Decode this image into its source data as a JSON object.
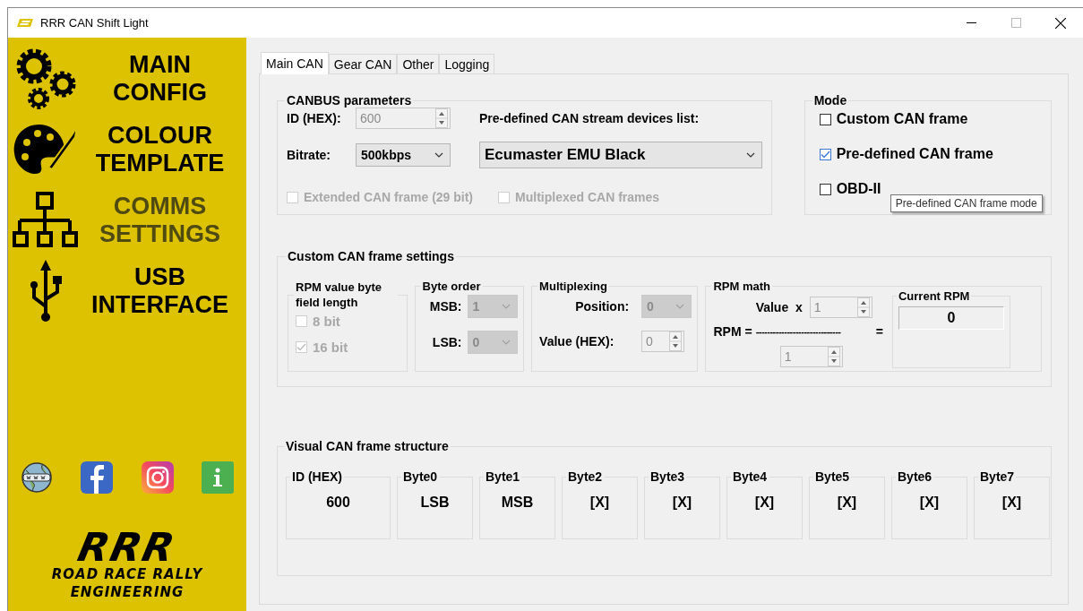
{
  "window": {
    "title": "RRR CAN Shift Light"
  },
  "sidebar": {
    "items": [
      {
        "kind": "gears",
        "label": "MAIN\nCONFIG",
        "selected": false
      },
      {
        "kind": "palette",
        "label": "COLOUR\nTEMPLATE",
        "selected": false
      },
      {
        "kind": "network",
        "label": "COMMS\nSETTINGS",
        "selected": true
      },
      {
        "kind": "usb",
        "label": "USB\nINTERFACE",
        "selected": false
      }
    ],
    "links": [
      {
        "kind": "web"
      },
      {
        "kind": "facebook"
      },
      {
        "kind": "instagram"
      },
      {
        "kind": "info"
      }
    ],
    "logo": {
      "title": "RRR",
      "line1": "ROAD RACE RALLY",
      "line2": "ENGINEERING"
    }
  },
  "tabs": [
    {
      "label": "Main CAN",
      "selected": true
    },
    {
      "label": "Gear CAN",
      "selected": false
    },
    {
      "label": "Other",
      "selected": false
    },
    {
      "label": "Logging",
      "selected": false
    }
  ],
  "canbus": {
    "title": "CANBUS parameters",
    "id_label": "ID (HEX):",
    "id_value": "600",
    "id_disabled": true,
    "bitrate_label": "Bitrate:",
    "bitrate_value": "500kbps",
    "devices_label": "Pre-defined CAN stream devices list:",
    "device_value": "Ecumaster EMU Black",
    "options": [
      {
        "label": "Extended CAN frame (29 bit)",
        "checked": false,
        "disabled": true
      },
      {
        "label": "Multiplexed CAN frames",
        "checked": false,
        "disabled": true
      }
    ]
  },
  "mode": {
    "title": "Mode",
    "options": [
      {
        "label": "Custom CAN frame",
        "checked": false,
        "disabled": false
      },
      {
        "label": "Pre-defined CAN frame",
        "checked": true,
        "disabled": false
      },
      {
        "label": "OBD-II",
        "checked": false,
        "disabled": false
      }
    ],
    "tooltip": "Pre-defined CAN frame mode"
  },
  "custom": {
    "title": "Custom CAN frame settings",
    "byte_length": {
      "title": "RPM value byte field length",
      "options": [
        {
          "label": "8 bit",
          "checked": false,
          "disabled": true
        },
        {
          "label": "16 bit",
          "checked": true,
          "disabled": true
        }
      ]
    },
    "byte_order": {
      "title": "Byte order",
      "msb_label": "MSB:",
      "msb_value": "1",
      "lsb_label": "LSB:",
      "lsb_value": "0",
      "disabled": true
    },
    "multiplexing": {
      "title": "Multiplexing",
      "position_label": "Position:",
      "position_value": "0",
      "value_label": "Value (HEX):",
      "value_value": "0",
      "disabled": true
    },
    "rpm_math": {
      "title": "RPM math",
      "value_label": "Value  x",
      "multiplier": "1",
      "rpm_label": "RPM =",
      "divider_line": "------------------------------",
      "equals": "=",
      "divisor": "1",
      "disabled": true,
      "current": {
        "title": "Current RPM",
        "value": "0"
      }
    }
  },
  "visual": {
    "title": "Visual CAN frame structure",
    "cells": [
      {
        "label": "ID (HEX)",
        "value": "600"
      },
      {
        "label": "Byte0",
        "value": "LSB"
      },
      {
        "label": "Byte1",
        "value": "MSB"
      },
      {
        "label": "Byte2",
        "value": "[X]"
      },
      {
        "label": "Byte3",
        "value": "[X]"
      },
      {
        "label": "Byte4",
        "value": "[X]"
      },
      {
        "label": "Byte5",
        "value": "[X]"
      },
      {
        "label": "Byte6",
        "value": "[X]"
      },
      {
        "label": "Byte7",
        "value": "[X]"
      }
    ]
  }
}
